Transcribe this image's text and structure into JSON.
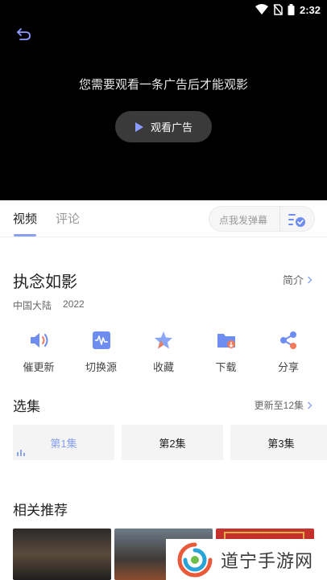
{
  "status": {
    "time": "2:32"
  },
  "player": {
    "ad_message": "您需要观看一条广告后才能观影",
    "ad_button": "观看广告"
  },
  "tabs": [
    {
      "label": "视频",
      "active": true
    },
    {
      "label": "评论",
      "active": false
    }
  ],
  "danmu": {
    "placeholder": "点我发弹幕"
  },
  "show": {
    "title": "执念如影",
    "intro_label": "简介",
    "region": "中国大陆",
    "year": "2022"
  },
  "actions": [
    {
      "label": "催更新",
      "icon": "speaker-icon"
    },
    {
      "label": "切换源",
      "icon": "waveform-icon"
    },
    {
      "label": "收藏",
      "icon": "star-icon"
    },
    {
      "label": "下载",
      "icon": "download-folder-icon"
    },
    {
      "label": "分享",
      "icon": "share-icon"
    }
  ],
  "episodes_section": {
    "title": "选集",
    "update_text": "更新至12集",
    "items": [
      {
        "label": "第1集",
        "active": true
      },
      {
        "label": "第2集",
        "active": false
      },
      {
        "label": "第3集",
        "active": false
      }
    ]
  },
  "recommend_section": {
    "title": "相关推荐"
  },
  "watermark": {
    "text": "道宁手游网"
  },
  "colors": {
    "accent": "#8aa0f0",
    "icon_blue": "#6d8df0",
    "player_bg": "#000000"
  }
}
